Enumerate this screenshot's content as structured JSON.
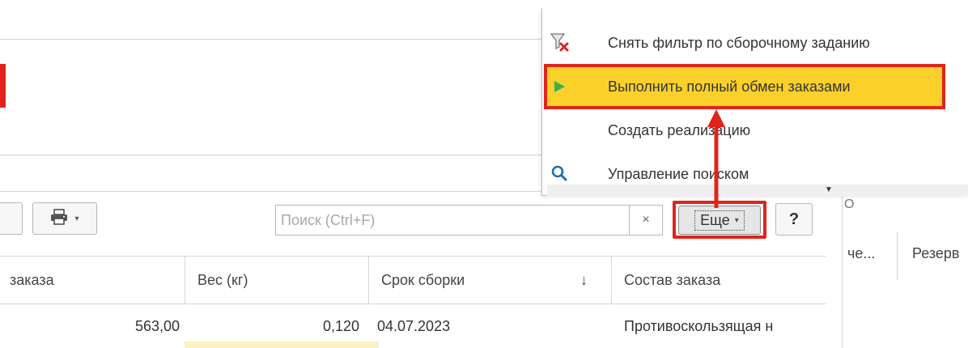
{
  "toolbar": {
    "search_placeholder": "Поиск (Ctrl+F)",
    "clear_label": "×",
    "more_label": "Еще",
    "more_caret": "▾",
    "help_label": "?",
    "print_caret": "▾"
  },
  "table": {
    "columns": [
      "заказа",
      "Вес (кг)",
      "Срок сборки",
      "Состав заказа"
    ],
    "sort_indicator": "↓",
    "rows": [
      {
        "order_amount": "563,00",
        "weight": "0,120",
        "assembly_date": "04.07.2023",
        "composition": "Противоскользящая н"
      }
    ]
  },
  "hidden_columns": {
    "partial_header": "О",
    "col_1": "че...",
    "col_2": "Резерв"
  },
  "menu": {
    "items": [
      {
        "label": "Снять фильтр по сборочному заданию",
        "icon": "filter-clear-icon"
      },
      {
        "label": "Выполнить полный обмен заказами",
        "icon": "play-icon",
        "highlighted": true
      },
      {
        "label": "Создать реализацию",
        "icon": ""
      },
      {
        "label": "Управление поиском",
        "icon": "search-icon"
      }
    ]
  },
  "colors": {
    "highlight": "#fbd02b",
    "annotation_red": "#e2231a",
    "play_green": "#3db14a",
    "search_blue": "#1f6fb2"
  }
}
